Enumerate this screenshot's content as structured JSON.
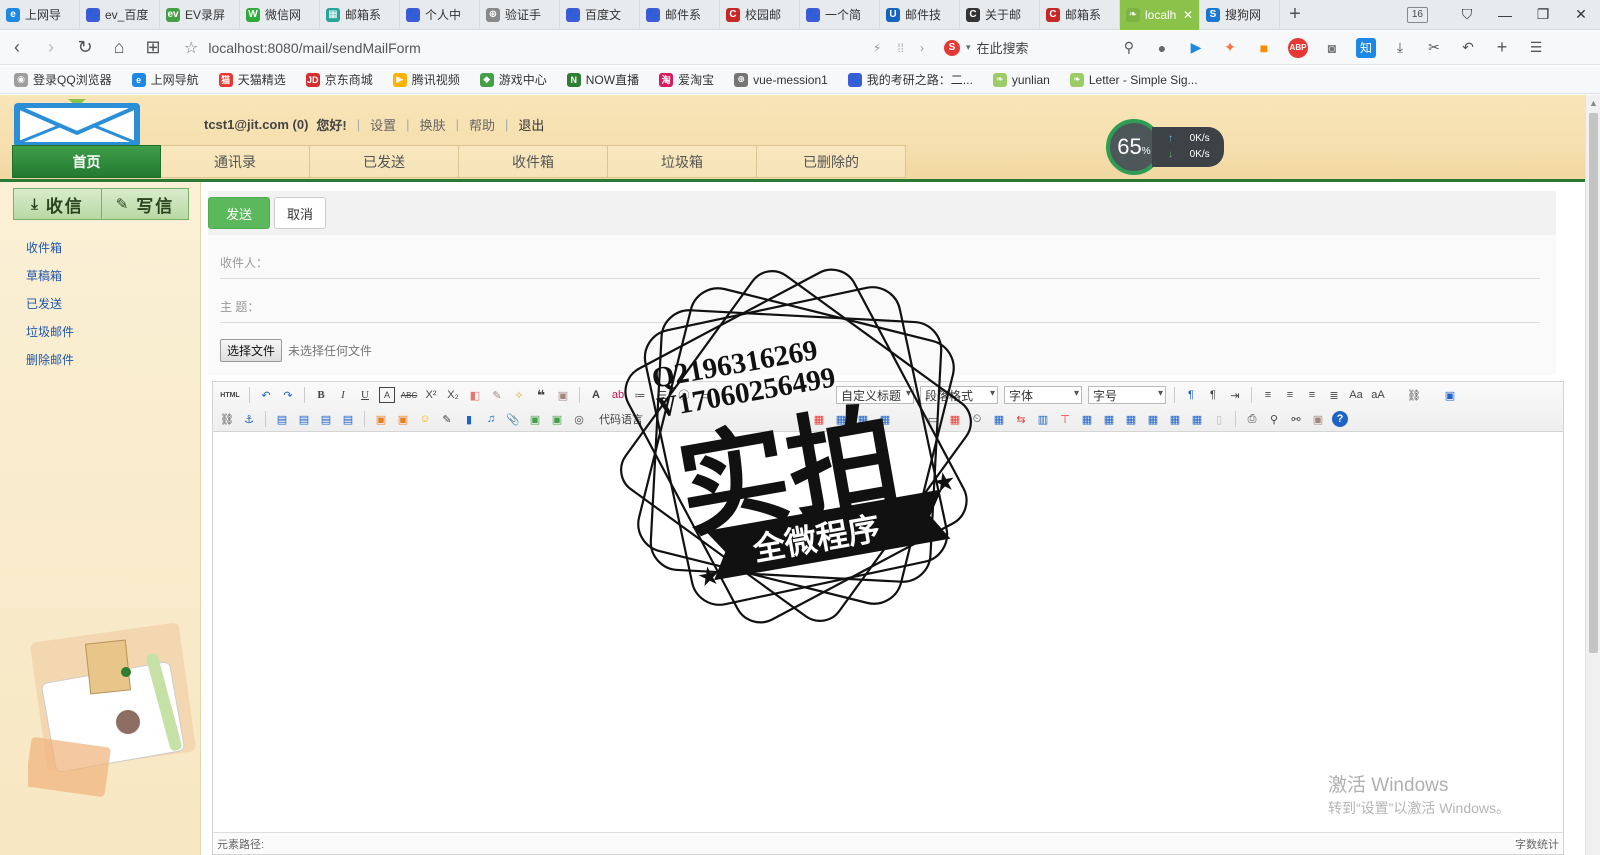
{
  "browser": {
    "tabs": [
      {
        "label": "上网导",
        "color": "#1e88e5",
        "letter": "e"
      },
      {
        "label": "ev_百度",
        "color": "#3b5bdb",
        "letter": "🐾"
      },
      {
        "label": "EV录屏",
        "color": "#43a047",
        "letter": "ev"
      },
      {
        "label": "微信网",
        "color": "#2eaa3a",
        "letter": "W"
      },
      {
        "label": "邮箱系",
        "color": "#26a69a",
        "letter": "▦"
      },
      {
        "label": "个人中",
        "color": "#3b5bdb",
        "letter": "🐾"
      },
      {
        "label": "验证手",
        "color": "#888888",
        "letter": "⊕"
      },
      {
        "label": "百度文",
        "color": "#3b5bdb",
        "letter": "🐾"
      },
      {
        "label": "邮件系",
        "color": "#3b5bdb",
        "letter": "🐾"
      },
      {
        "label": "校园邮",
        "color": "#c62828",
        "letter": "C"
      },
      {
        "label": "一个简",
        "color": "#3b5bdb",
        "letter": "🐾"
      },
      {
        "label": "邮件技",
        "color": "#1565c0",
        "letter": "U"
      },
      {
        "label": "关于邮",
        "color": "#333333",
        "letter": "C"
      },
      {
        "label": "邮箱系",
        "color": "#c62828",
        "letter": "C"
      },
      {
        "label": "localh",
        "color": "#7cb342",
        "letter": "❧",
        "active": true
      },
      {
        "label": "搜狗网",
        "color": "#1976d2",
        "letter": "S"
      }
    ],
    "tab_count": "16",
    "url": "localhost:8080/mail/sendMailForm",
    "search_placeholder": "在此搜索",
    "bookmarks": [
      {
        "label": "登录QQ浏览器",
        "color": "#9e9e9e",
        "letter": "◉"
      },
      {
        "label": "上网导航",
        "color": "#1e88e5",
        "letter": "e"
      },
      {
        "label": "天猫精选",
        "color": "#e53935",
        "letter": "猫"
      },
      {
        "label": "京东商城",
        "color": "#d32f2f",
        "letter": "JD"
      },
      {
        "label": "腾讯视频",
        "color": "#ffb300",
        "letter": "▶"
      },
      {
        "label": "游戏中心",
        "color": "#43a047",
        "letter": "◆"
      },
      {
        "label": "NOW直播",
        "color": "#2e7d32",
        "letter": "N"
      },
      {
        "label": "爱淘宝",
        "color": "#d81b60",
        "letter": "淘"
      },
      {
        "label": "vue-mession1",
        "color": "#757575",
        "letter": "⊕"
      },
      {
        "label": "我的考研之路：二...",
        "color": "#3b5bdb",
        "letter": "🐾"
      },
      {
        "label": "yunlian",
        "color": "#9ccc65",
        "letter": "❧"
      },
      {
        "label": "Letter - Simple Sig...",
        "color": "#9ccc65",
        "letter": "❧"
      }
    ]
  },
  "header": {
    "user": "tcst1@jit.com (0)",
    "greeting": "您好!",
    "links": [
      "设置",
      "换肤",
      "帮助",
      "退出"
    ],
    "nav_tabs": [
      "首页",
      "通讯录",
      "已发送",
      "收件箱",
      "垃圾箱",
      "已删除的"
    ],
    "speed": {
      "percent": "65",
      "unit": "%",
      "up": "0K/s",
      "down": "0K/s"
    }
  },
  "sidebar": {
    "receive_label": "收信",
    "write_label": "写信",
    "items": [
      "收件箱",
      "草稿箱",
      "已发送",
      "垃圾邮件",
      "删除邮件"
    ]
  },
  "compose": {
    "send_label": "发送",
    "cancel_label": "取消",
    "to_label": "收件人：",
    "subject_label": "主 题：",
    "file_button": "选择文件",
    "file_status": "未选择任何文件"
  },
  "editor": {
    "html_label": "HTML",
    "custom_title": "自定义标题",
    "paragraph_format": "段落格式",
    "font_family": "字体",
    "font_size": "字号",
    "code_language": "代码语言",
    "element_path": "元素路径:",
    "word_count": "字数统计"
  },
  "overlay": {
    "win_title": "激活 Windows",
    "win_sub": "转到“设置”以激活 Windows。",
    "stamp_line1": "Q2196316269",
    "stamp_line2": "V17060256499",
    "stamp_main": "实拍",
    "stamp_ribbon": "全微程序"
  }
}
